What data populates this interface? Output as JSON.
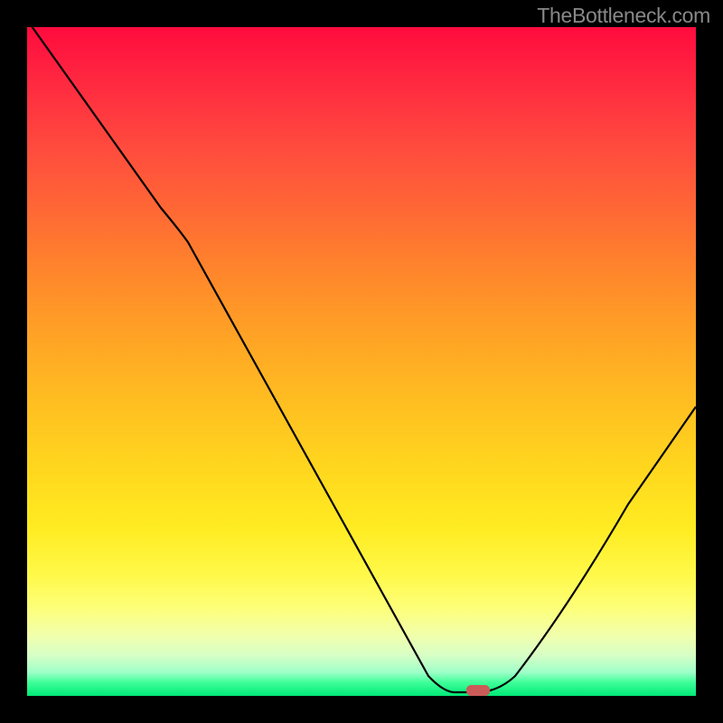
{
  "watermark": "TheBottleneck.com",
  "chart_data": {
    "type": "line",
    "title": "",
    "xlabel": "",
    "ylabel": "",
    "xlim": [
      0,
      100
    ],
    "ylim": [
      0,
      100
    ],
    "grid": false,
    "curve_points": [
      {
        "x": 0,
        "y": 101
      },
      {
        "x": 20,
        "y": 73
      },
      {
        "x": 24,
        "y": 68
      },
      {
        "x": 60,
        "y": 3
      },
      {
        "x": 63,
        "y": 0.5
      },
      {
        "x": 68,
        "y": 0.5
      },
      {
        "x": 72,
        "y": 2
      },
      {
        "x": 80,
        "y": 12
      },
      {
        "x": 90,
        "y": 27
      },
      {
        "x": 100,
        "y": 43
      }
    ],
    "annotations": [
      {
        "type": "marker",
        "x": 67.5,
        "y": 0.8,
        "color": "#ca5b58"
      }
    ],
    "colors": {
      "top": "#ff0b3e",
      "mid": "#ffd91e",
      "bottom": "#00e877"
    }
  }
}
